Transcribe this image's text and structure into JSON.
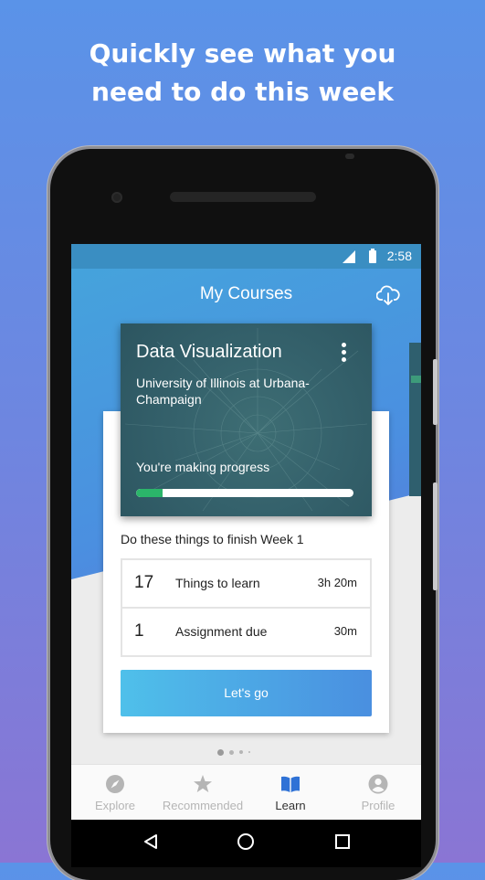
{
  "promo": {
    "headline_line1": "Quickly see what you",
    "headline_line2": "need to do this week"
  },
  "status_bar": {
    "time": "2:58"
  },
  "header": {
    "title": "My Courses",
    "download_icon": "cloud-download-icon"
  },
  "course_card": {
    "title": "Data Visualization",
    "institution": "University of Illinois at Urbana-Champaign",
    "progress_label": "You're making progress",
    "progress_fraction": 0.12,
    "menu_icon": "more-vertical-icon"
  },
  "week": {
    "heading": "Do these things to finish Week 1",
    "tasks": [
      {
        "count": "17",
        "label": "Things to learn",
        "duration": "3h 20m"
      },
      {
        "count": "1",
        "label": "Assignment due",
        "duration": "30m"
      }
    ],
    "cta_label": "Let's go"
  },
  "pager": {
    "pages": 4,
    "active_index": 0
  },
  "bottom_nav": {
    "items": [
      {
        "label": "Explore",
        "icon": "compass-icon",
        "active": false
      },
      {
        "label": "Recommended",
        "icon": "star-icon",
        "active": false
      },
      {
        "label": "Learn",
        "icon": "book-icon",
        "active": true
      },
      {
        "label": "Profile",
        "icon": "profile-icon",
        "active": false
      }
    ]
  },
  "colors": {
    "accent": "#4a8fe0",
    "progress_fill": "#2bb56a",
    "status_bar": "#3a8ec2",
    "course_card_bg": "#35626c"
  }
}
